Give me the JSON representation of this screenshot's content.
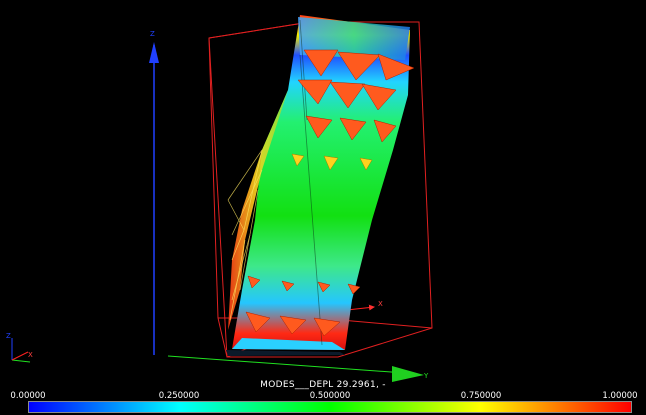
{
  "scalar_bar": {
    "title": "MODES___DEPL 29.2961, -",
    "ticks": [
      {
        "label": "0.00000",
        "value": 0.0
      },
      {
        "label": "0.250000",
        "value": 0.25
      },
      {
        "label": "0.500000",
        "value": 0.5
      },
      {
        "label": "0.750000",
        "value": 0.75
      },
      {
        "label": "1.00000",
        "value": 1.0
      }
    ],
    "range": [
      0.0,
      1.0
    ],
    "colors": [
      "#0000ff",
      "#00ffff",
      "#00ff00",
      "#ffff00",
      "#ff0000"
    ]
  },
  "axes": {
    "main_x": "X",
    "main_y": "Y",
    "main_z": "Z",
    "corner_x": "X",
    "corner_z": "Z"
  },
  "colors": {
    "background": "#000000",
    "bounding_box": "#e02020",
    "axis_x": "#ff2020",
    "axis_y": "#20e020",
    "axis_z": "#2040ff",
    "glyph_high": "#ff5a1e",
    "glyph_mid": "#ffd21e"
  }
}
